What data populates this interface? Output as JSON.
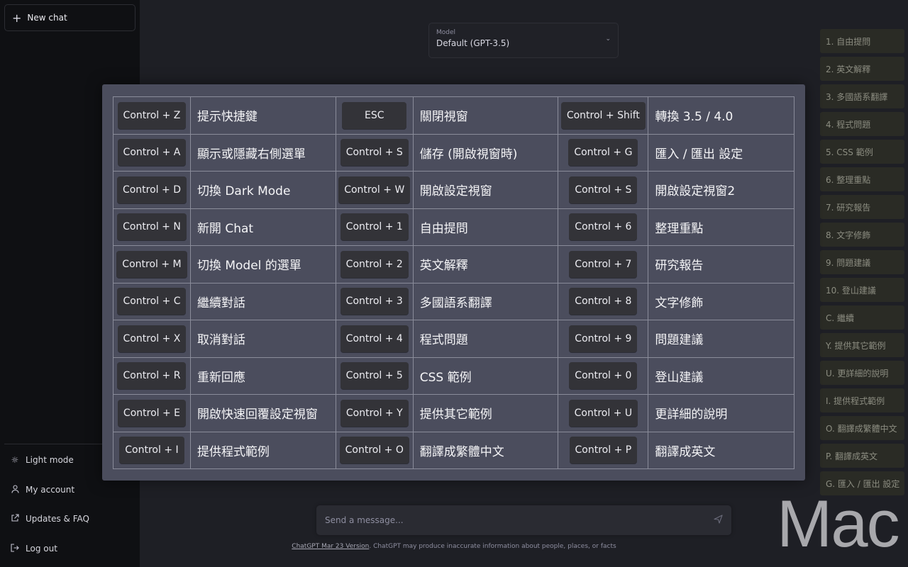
{
  "sidebar": {
    "new_chat": "New chat",
    "bottom": [
      {
        "label": "Light mode",
        "icon": "sun-icon"
      },
      {
        "label": "My account",
        "icon": "user-icon"
      },
      {
        "label": "Updates & FAQ",
        "icon": "external-link-icon"
      },
      {
        "label": "Log out",
        "icon": "logout-icon"
      }
    ]
  },
  "model": {
    "label": "Model",
    "value": "Default (GPT-3.5)"
  },
  "shortcuts": [
    [
      {
        "key": "Control + Z",
        "desc": "提示快捷鍵"
      },
      {
        "key": "ESC",
        "desc": "關閉視窗"
      },
      {
        "key": "Control + Shift",
        "desc": "轉換 3.5 / 4.0"
      }
    ],
    [
      {
        "key": "Control + A",
        "desc": "顯示或隱藏右側選單"
      },
      {
        "key": "Control + S",
        "desc": "儲存 (開啟視窗時)"
      },
      {
        "key": "Control + G",
        "desc": "匯入 / 匯出 設定"
      }
    ],
    [
      {
        "key": "Control + D",
        "desc": "切換 Dark Mode"
      },
      {
        "key": "Control + W",
        "desc": "開啟設定視窗"
      },
      {
        "key": "Control + S",
        "desc": "開啟設定視窗2"
      }
    ],
    [
      {
        "key": "Control + N",
        "desc": "新開 Chat"
      },
      {
        "key": "Control + 1",
        "desc": "自由提問"
      },
      {
        "key": "Control + 6",
        "desc": "整理重點"
      }
    ],
    [
      {
        "key": "Control + M",
        "desc": "切換 Model 的選單"
      },
      {
        "key": "Control + 2",
        "desc": "英文解釋"
      },
      {
        "key": "Control + 7",
        "desc": "研究報告"
      }
    ],
    [
      {
        "key": "Control + C",
        "desc": "繼續對話"
      },
      {
        "key": "Control + 3",
        "desc": "多國語系翻譯"
      },
      {
        "key": "Control + 8",
        "desc": "文字修飾"
      }
    ],
    [
      {
        "key": "Control + X",
        "desc": "取消對話"
      },
      {
        "key": "Control + 4",
        "desc": "程式問題"
      },
      {
        "key": "Control + 9",
        "desc": "問題建議"
      }
    ],
    [
      {
        "key": "Control + R",
        "desc": "重新回應"
      },
      {
        "key": "Control + 5",
        "desc": "CSS 範例"
      },
      {
        "key": "Control + 0",
        "desc": "登山建議"
      }
    ],
    [
      {
        "key": "Control + E",
        "desc": "開啟快速回覆設定視窗"
      },
      {
        "key": "Control + Y",
        "desc": "提供其它範例"
      },
      {
        "key": "Control + U",
        "desc": "更詳細的說明"
      }
    ],
    [
      {
        "key": "Control + I",
        "desc": "提供程式範例"
      },
      {
        "key": "Control + O",
        "desc": "翻譯成繁體中文"
      },
      {
        "key": "Control + P",
        "desc": "翻譯成英文"
      }
    ]
  ],
  "prompt_list": [
    "1. 自由提問",
    "2. 英文解釋",
    "3. 多國語系翻譯",
    "4. 程式問題",
    "5. CSS 範例",
    "6. 整理重點",
    "7. 研究報告",
    "8. 文字修飾",
    "9. 問題建議",
    "10. 登山建議",
    "C. 繼續",
    "Y. 提供其它範例",
    "U. 更詳細的說明",
    "I. 提供程式範例",
    "O. 翻譯成繁體中文",
    "P. 翻譯成英文",
    "G. 匯入 / 匯出 設定"
  ],
  "composer": {
    "placeholder": "Send a message..."
  },
  "footer": {
    "link": "ChatGPT Mar 23 Version",
    "text": ". ChatGPT may produce inaccurate information about people, places, or facts"
  },
  "watermark": "Mac",
  "colors": {
    "background": "#1e1f25",
    "sidebar": "#0f1013",
    "modal": "#4b4d5d",
    "key": "#333338",
    "prompt_item": "#2a2b25"
  }
}
